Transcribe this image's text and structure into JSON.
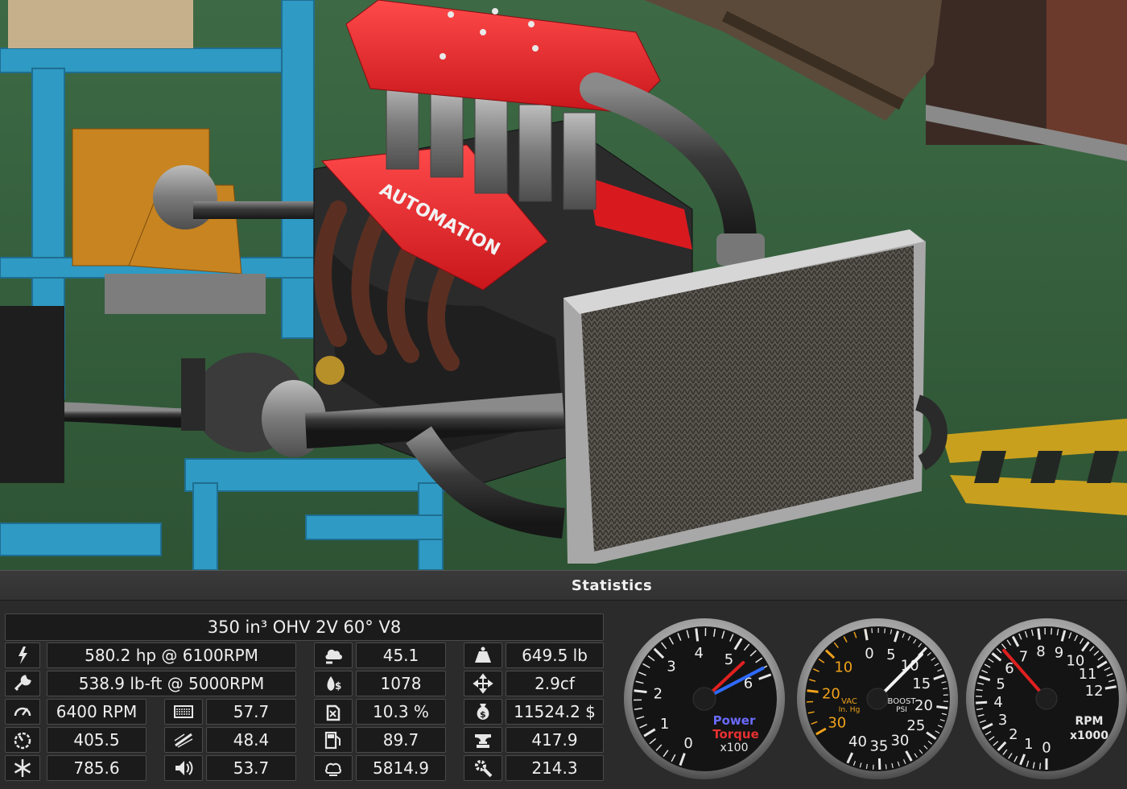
{
  "scene": {
    "valve_cover_logo": "AUTOMATION"
  },
  "stats": {
    "title": "Statistics",
    "engine_name": "350 in³ OHV 2V 60° V8",
    "power": "580.2 hp @ 6100RPM",
    "torque": "538.9 lb-ft @ 5000RPM",
    "max_rpm": "6400 RPM",
    "redline_stat": "405.5",
    "cooling": "785.6",
    "intake_stat": "57.7",
    "responsiveness": "48.4",
    "noise": "53.7",
    "emissions": "45.1",
    "fuel_economy": "1078",
    "efficiency": "10.3 %",
    "octane": "89.7",
    "economy_flow": "5814.9",
    "weight": "649.5 lb",
    "size": "2.9cf",
    "cost": "11524.2 $",
    "production_units": "417.9",
    "service_cost": "214.3"
  },
  "icons": {
    "power": "lightning-icon",
    "torque": "wrench-icon",
    "rpm": "speedometer-icon",
    "redline": "tachometer-icon",
    "cooling": "snowflake-icon",
    "intake": "radiator-icon",
    "responsiveness": "gauge-needle-icon",
    "noise": "speaker-icon",
    "emissions": "emissions-cloud-icon",
    "fuel_economy": "fuel-dollar-icon",
    "efficiency": "jerrycan-icon",
    "octane": "fuel-pump-icon",
    "economy_flow": "exhaust-cloud-icon",
    "weight": "weight-icon",
    "size": "size-arrows-icon",
    "cost": "money-bag-icon",
    "production_units": "anvil-icon",
    "service_cost": "gear-wrench-icon"
  },
  "gauges": {
    "power_torque": {
      "ticks": [
        "0",
        "1",
        "2",
        "3",
        "4",
        "5",
        "6"
      ],
      "power_label": "Power",
      "torque_label": "Torque",
      "unit": "x100",
      "power_value": 5.8,
      "torque_value": 5.4,
      "power_color": "#2f6bff",
      "torque_color": "#e02020"
    },
    "boost": {
      "vac_ticks": [
        "0",
        "10",
        "20",
        "30"
      ],
      "boost_ticks": [
        "5",
        "10",
        "15",
        "20",
        "25",
        "30",
        "35",
        "40"
      ],
      "vac_label": "VAC",
      "vac_unit": "In. Hg",
      "boost_label": "BOOST",
      "boost_unit": "PSI",
      "value_psi": 10.2,
      "vac_color": "#f0a21a"
    },
    "tach": {
      "ticks": [
        "0",
        "1",
        "2",
        "3",
        "4",
        "5",
        "6",
        "7",
        "8",
        "9",
        "10",
        "11",
        "12"
      ],
      "label": "RPM",
      "unit": "x1000",
      "value": 6.4,
      "needle_color": "#e02020"
    }
  }
}
